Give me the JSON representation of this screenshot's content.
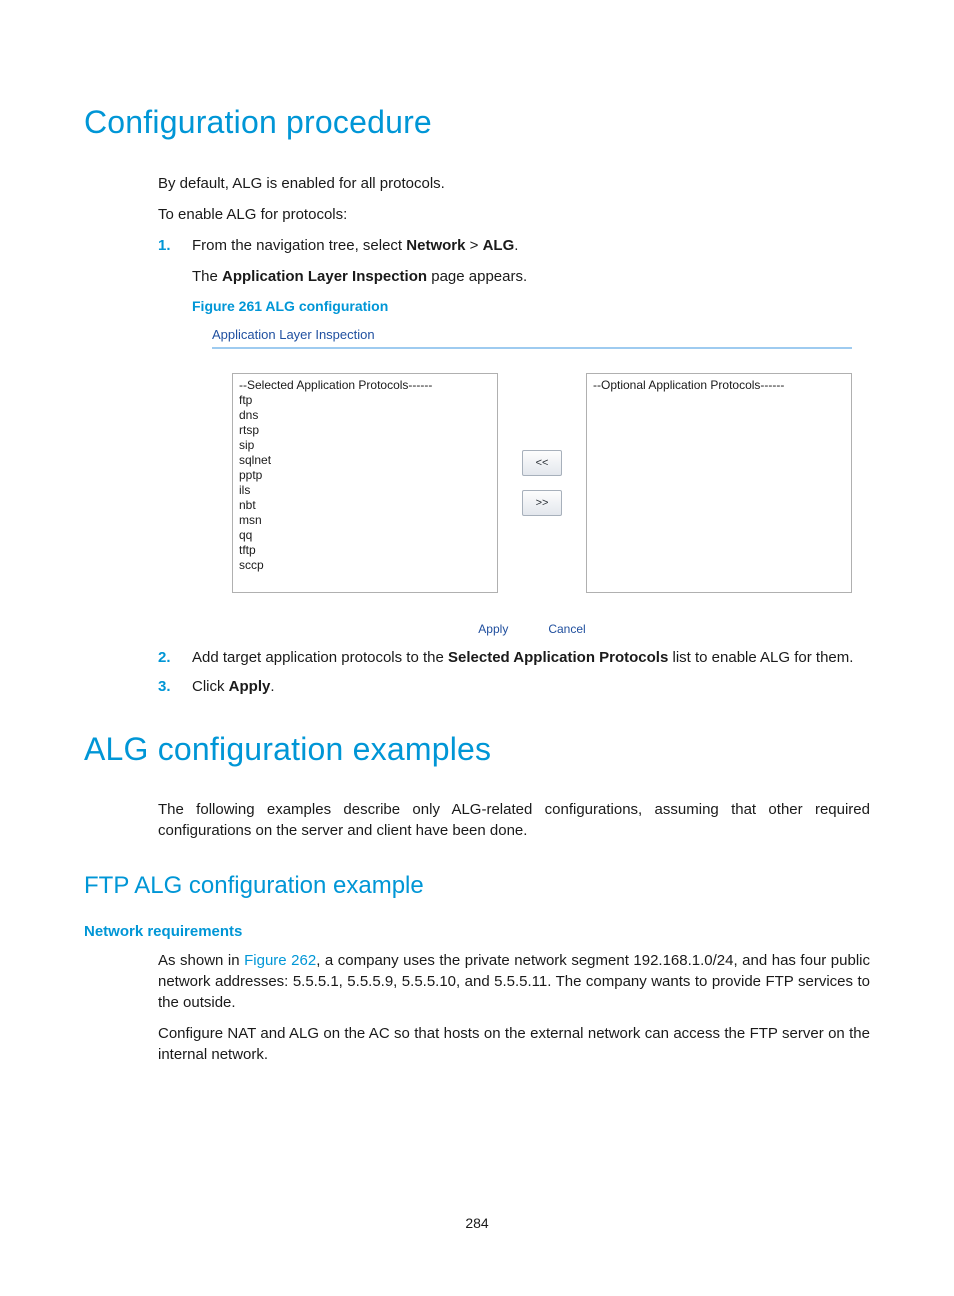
{
  "h1_1": "Configuration procedure",
  "intro": {
    "p1": "By default, ALG is enabled for all protocols.",
    "p2": "To enable ALG for protocols:"
  },
  "steps_a": {
    "s1": {
      "num": "1.",
      "text_pre": "From the navigation tree, select ",
      "strong1": "Network",
      "text_mid": " > ",
      "strong2": "ALG",
      "text_post": ".",
      "line2_pre": "The ",
      "line2_strong": "Application Layer Inspection",
      "line2_post": " page appears.",
      "figcap": "Figure 261 ALG configuration"
    }
  },
  "figure": {
    "header": "Application Layer Inspection",
    "selected_header": "--Selected Application Protocols------",
    "optional_header": "--Optional Application Protocols------",
    "selected_items": [
      "ftp",
      "dns",
      "rtsp",
      "sip",
      "sqlnet",
      "pptp",
      "ils",
      "nbt",
      "msn",
      "qq",
      "tftp",
      "sccp"
    ],
    "move_left_label": "<<",
    "move_right_label": ">>",
    "apply_label": "Apply",
    "cancel_label": "Cancel"
  },
  "steps_b": {
    "s2": {
      "num": "2.",
      "pre": "Add target application protocols to the ",
      "strong": "Selected Application Protocols",
      "post": " list to enable ALG for them."
    },
    "s3": {
      "num": "3.",
      "pre": "Click ",
      "strong": "Apply",
      "post": "."
    }
  },
  "h1_2": "ALG configuration examples",
  "examples_intro": "The following examples describe only ALG-related configurations, assuming that other required configurations on the server and client have been done.",
  "h2_1": "FTP ALG configuration example",
  "h4_1": "Network requirements",
  "netreq": {
    "p1_pre": "As shown in ",
    "p1_link": "Figure 262",
    "p1_post": ", a company uses the private network segment 192.168.1.0/24, and has four public network addresses: 5.5.5.1, 5.5.5.9, 5.5.5.10, and 5.5.5.11. The company wants to provide FTP services to the outside.",
    "p2": "Configure NAT and ALG on the AC so that hosts on the external network can access the FTP server on the internal network."
  },
  "page_number": "284"
}
